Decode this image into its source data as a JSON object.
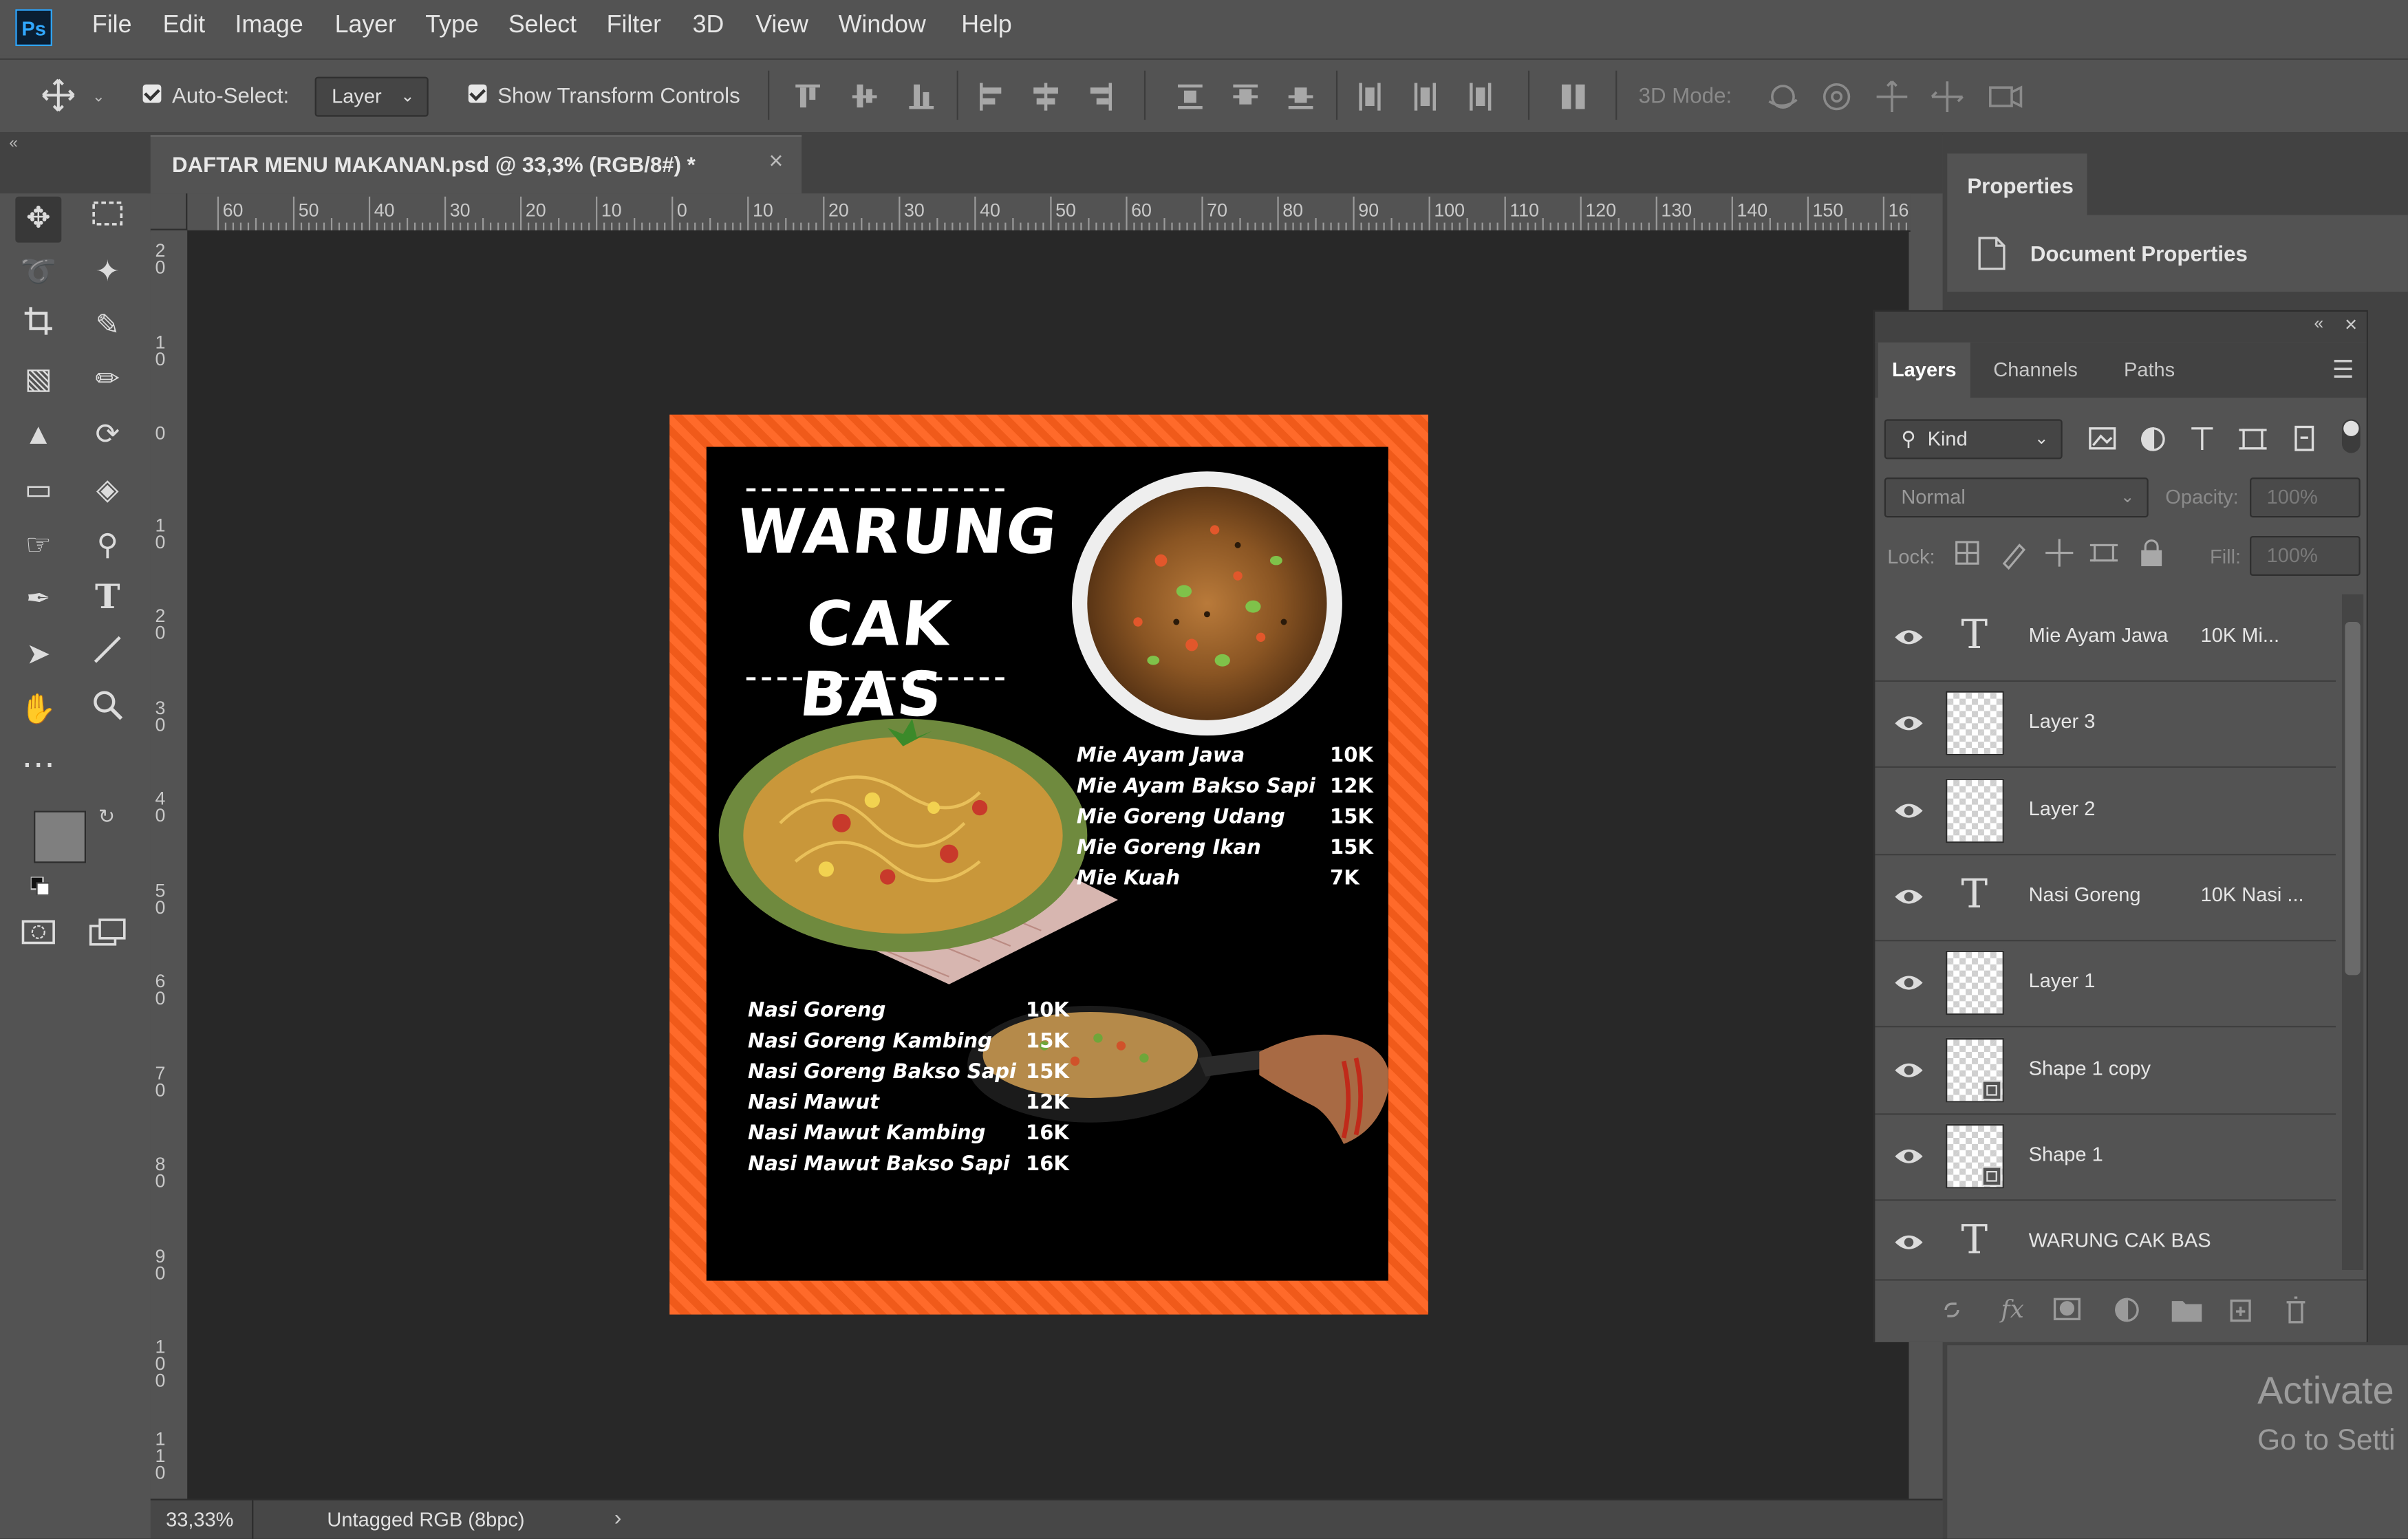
{
  "app": {
    "logo": "Ps"
  },
  "menubar": [
    "File",
    "Edit",
    "Image",
    "Layer",
    "Type",
    "Select",
    "Filter",
    "3D",
    "View",
    "Window",
    "Help"
  ],
  "options": {
    "auto_select_label": "Auto-Select:",
    "auto_select_value": "Layer",
    "show_transform_label": "Show Transform Controls",
    "mode_3d_label": "3D Mode:"
  },
  "document": {
    "tab_title": "DAFTAR MENU MAKANAN.psd @ 33,3% (RGB/8#) *",
    "zoom": "33,33%",
    "color_profile": "Untagged RGB (8bpc)"
  },
  "ruler": {
    "h_labels": [
      "60",
      "50",
      "40",
      "30",
      "20",
      "10",
      "0",
      "10",
      "20",
      "30",
      "40",
      "50",
      "60",
      "70",
      "80",
      "90",
      "100",
      "110",
      "120",
      "130",
      "140",
      "150",
      "16"
    ],
    "v_labels": [
      "2\n0",
      "1\n0",
      "0",
      "1\n0",
      "2\n0",
      "3\n0",
      "4\n0",
      "5\n0",
      "6\n0",
      "7\n0",
      "8\n0",
      "9\n0",
      "1\n0\n0",
      "1\n1\n0"
    ]
  },
  "properties": {
    "tab": "Properties",
    "item": "Document Properties"
  },
  "layers_panel": {
    "tabs": [
      "Layers",
      "Channels",
      "Paths"
    ],
    "filter_kind": "Kind",
    "blend_mode": "Normal",
    "opacity_label": "Opacity:",
    "opacity_value": "100%",
    "lock_label": "Lock:",
    "fill_label": "Fill:",
    "fill_value": "100%",
    "layers": [
      {
        "type": "text",
        "name": "Mie Ayam Jawa",
        "preview": "10K Mi..."
      },
      {
        "type": "pixel",
        "name": "Layer 3"
      },
      {
        "type": "pixel",
        "name": "Layer 2"
      },
      {
        "type": "text",
        "name": "Nasi Goreng",
        "preview": "10K Nasi ..."
      },
      {
        "type": "pixel",
        "name": "Layer 1"
      },
      {
        "type": "shape",
        "name": "Shape 1 copy"
      },
      {
        "type": "shape",
        "name": "Shape 1"
      },
      {
        "type": "text",
        "name": "WARUNG CAK BAS"
      }
    ]
  },
  "artwork": {
    "title_line1": "WARUNG",
    "title_line2": "CAK BAS",
    "mie_items": [
      {
        "name": "Mie Ayam Jawa",
        "price": "10K"
      },
      {
        "name": "Mie Ayam Bakso Sapi",
        "price": "12K"
      },
      {
        "name": "Mie Goreng Udang",
        "price": "15K"
      },
      {
        "name": "Mie Goreng Ikan",
        "price": "15K"
      },
      {
        "name": "Mie Kuah",
        "price": "7K"
      }
    ],
    "nasi_items": [
      {
        "name": "Nasi Goreng",
        "price": "10K"
      },
      {
        "name": "Nasi Goreng Kambing",
        "price": "15K"
      },
      {
        "name": "Nasi Goreng Bakso Sapi",
        "price": "15K"
      },
      {
        "name": "Nasi Mawut",
        "price": "12K"
      },
      {
        "name": "Nasi Mawut Kambing",
        "price": "16K"
      },
      {
        "name": "Nasi Mawut Bakso Sapi",
        "price": "16K"
      }
    ],
    "border_color": "#ff6a2a"
  },
  "os_watermark": {
    "line1": "Activate",
    "line2": "Go to Setti"
  },
  "colors": {
    "accent": "#31a8ff",
    "ui_bg": "#535353",
    "canvas_bg": "#282828",
    "panel_dark": "#424242"
  }
}
